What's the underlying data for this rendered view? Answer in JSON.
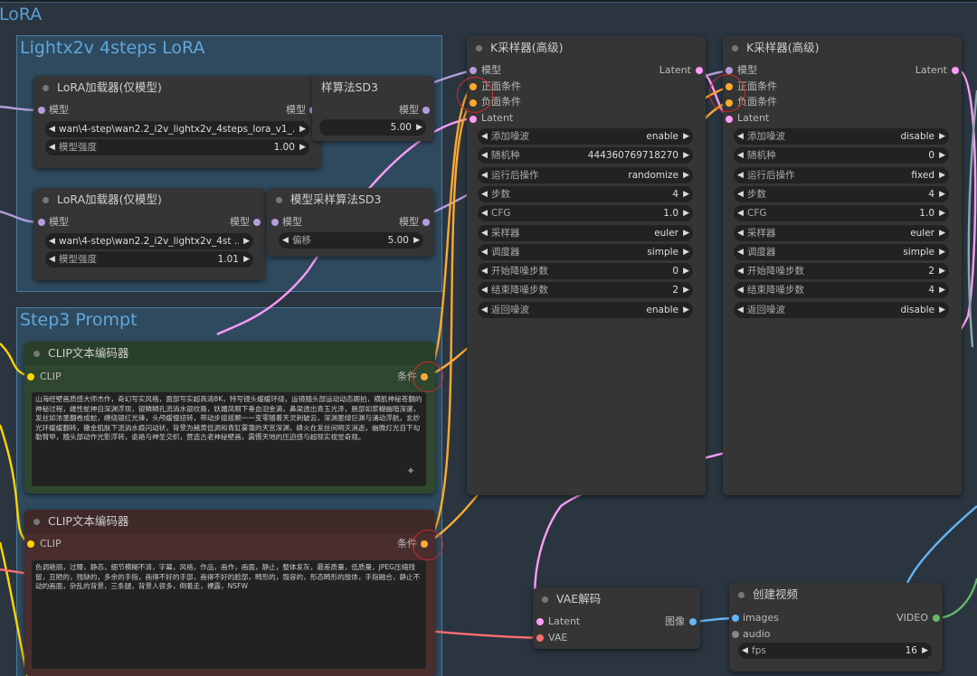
{
  "colors": {
    "model": "#b39ddb",
    "cond": "#ffa931",
    "latent": "#ff9cf9",
    "clip": "#ffd500",
    "vae": "#ff6e6e",
    "image": "#64b5f6",
    "video": "#66bb6a"
  },
  "groups": {
    "lora_group": "LoRA",
    "lightx2v": "Lightx2v 4steps LoRA",
    "step3": "Step3 Prompt"
  },
  "lora1": {
    "title": "LoRA加载器(仅模型)",
    "in_model": "模型",
    "out_model": "模型",
    "lora_name": "wan\\4-step\\wan2.2_i2v_lightx2v_4steps_lora_v1_...",
    "strength_label": "模型强度",
    "strength": "1.00"
  },
  "lora2": {
    "title": "LoRA加载器(仅模型)",
    "in_model": "模型",
    "out_model": "模型",
    "lora_name": "wan\\4-step\\wan2.2_i2v_lightx2v_4st ...",
    "strength_label": "模型强度",
    "strength": "1.01"
  },
  "sd3a": {
    "title": "样算法SD3",
    "out_model": "模型",
    "shift_value": "5.00"
  },
  "sd3b": {
    "title": "模型采样算法SD3",
    "in_model": "模型",
    "out_model": "模型",
    "shift_label": "偏移",
    "shift_value": "5.00"
  },
  "ks1": {
    "title": "K采样器(高级)",
    "in_model": "模型",
    "in_pos": "正面条件",
    "in_neg": "负面条件",
    "in_latent": "Latent",
    "out_latent": "Latent",
    "widgets": [
      {
        "label": "添加噪波",
        "value": "enable"
      },
      {
        "label": "随机种",
        "value": "444360769718270"
      },
      {
        "label": "运行后操作",
        "value": "randomize"
      },
      {
        "label": "步数",
        "value": "4"
      },
      {
        "label": "CFG",
        "value": "1.0"
      },
      {
        "label": "采样器",
        "value": "euler"
      },
      {
        "label": "调度器",
        "value": "simple"
      },
      {
        "label": "开始降噪步数",
        "value": "0"
      },
      {
        "label": "结束降噪步数",
        "value": "2"
      },
      {
        "label": "返回噪波",
        "value": "enable"
      }
    ]
  },
  "ks2": {
    "title": "K采样器(高级)",
    "in_model": "模型",
    "in_pos": "正面条件",
    "in_neg": "负面条件",
    "in_latent": "Latent",
    "out_latent": "Latent",
    "widgets": [
      {
        "label": "添加噪波",
        "value": "disable"
      },
      {
        "label": "随机种",
        "value": "0"
      },
      {
        "label": "运行后操作",
        "value": "fixed"
      },
      {
        "label": "步数",
        "value": "4"
      },
      {
        "label": "CFG",
        "value": "1.0"
      },
      {
        "label": "采样器",
        "value": "euler"
      },
      {
        "label": "调度器",
        "value": "simple"
      },
      {
        "label": "开始降噪步数",
        "value": "2"
      },
      {
        "label": "结束降噪步数",
        "value": "4"
      },
      {
        "label": "返回噪波",
        "value": "disable"
      }
    ]
  },
  "clip_pos": {
    "title": "CLIP文本编码器",
    "in_clip": "CLIP",
    "out_cond": "条件",
    "text": "山海经壁画质感大师杰作，奇幻写实风格，面部写实超高清8K，特写镜头缓缓环绕，运镜随头部运动动态跟拍，横肌神秘苍翻的神秘过程，雌性蛇神自深渊浮现，银鳞鳞孔流淌水银纹路，妖媚凤眼下垂血泪金滴，鼻梁透出青玉光泽，唇部如浆糊幽暗深邃，发丝如浓墨翻卷成蛇，缠绕银红光锋，头颅缓慢扭转，带动步摇摇颤一一变零随着天灵刺破云，深渊墨绿巨渊与涌动浮航，玄妙光环缓缓翻转，撒金肌肤下流淌水痕闪动状，背景为赭黄低调和青缸雾霭的天宫深渊，磷火在发丝间明灭消逝，幽微灯光自下勾勒臂甲，随头部动作光影浮转，诡艳与神圣交织，营造古老神秘壁画，震慑天地的压迫感与超现实视觉奇观。"
  },
  "clip_neg": {
    "title": "CLIP文本编码器",
    "in_clip": "CLIP",
    "out_cond": "条件",
    "text": "色调艳丽，过曝，静态，细节模糊不清，字幕，风格，作品，画作，画面，静止，整体发灰，最差质量，低质量，JPEG压缩残留，丑陋的，残缺的，多余的手指，画得不好的手部，画得不好的脸部，畸形的，毁容的，形态畸形的肢体，手指融合，静止不动的画面，杂乱的背景，三条腿，背景人很多，倒着走，裸露，NSFW"
  },
  "vae": {
    "title": "VAE解码",
    "in_latent": "Latent",
    "in_vae": "VAE",
    "out_image": "图像"
  },
  "video": {
    "title": "创建视频",
    "in_images": "images",
    "in_audio": "audio",
    "out_video": "VIDEO",
    "fps_label": "fps",
    "fps_value": "16"
  }
}
